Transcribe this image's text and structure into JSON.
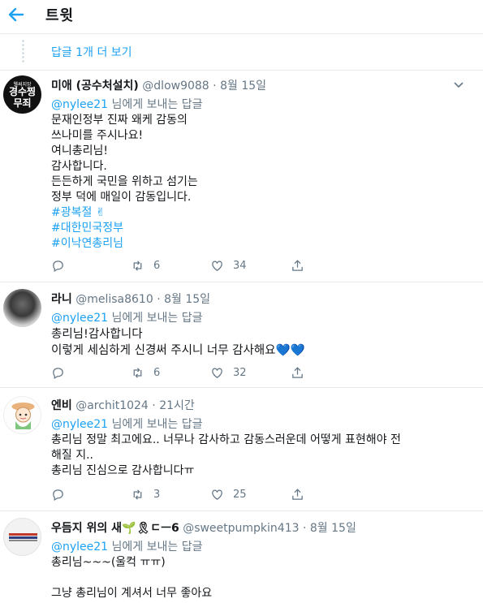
{
  "header": {
    "title": "트윗"
  },
  "more_replies": {
    "label": "답글 1개 더 보기"
  },
  "tweets": [
    {
      "name": "미애 (공수처설치)",
      "handle": "@dlow9088",
      "sep": "·",
      "time": "8월 15일",
      "avatar_text": [
        "경수찡",
        "무죄"
      ],
      "avatar_small": "웰써지망",
      "reply_to": "@nylee21",
      "reply_suffix": " 님에게 보내는 답글",
      "lines": [
        "문재인정부  진짜 왜케 감동의",
        "쓰나미를 주시나요!",
        "여니총리님!",
        "감사합니다.",
        "든든하게 국민을 위하고 섬기는",
        "정부 덕에 매일이 감동입니다."
      ],
      "tags": [
        "#광복절 ✌",
        "#대한민국정부",
        "#이낙연총리님"
      ],
      "retweets": "6",
      "likes": "34"
    },
    {
      "name": "라니",
      "handle": "@melisa8610",
      "sep": "·",
      "time": "8월 15일",
      "reply_to": "@nylee21",
      "reply_suffix": " 님에게 보내는 답글",
      "lines": [
        "총리님!감사합니다",
        "이렇게 세심하게 신경써 주시니 너무 감사해요💙💙"
      ],
      "tags": [],
      "retweets": "6",
      "likes": "32"
    },
    {
      "name": "엔비",
      "handle": "@archit1024",
      "sep": "·",
      "time": "21시간",
      "reply_to": "@nylee21",
      "reply_suffix": " 님에게 보내는 답글",
      "lines": [
        "총리님 정말 최고에요.. 너무나 감사하고 감동스러운데 어떻게 표현해야 전",
        "해질 지..",
        "총리님 진심으로 감사합니다ㅠ"
      ],
      "tags": [],
      "retweets": "3",
      "likes": "25"
    },
    {
      "name": "우듬지 위의 새🌱🎗ㄷㅡ6",
      "handle": "@sweetpumpkin413",
      "sep": "·",
      "time": "8월 15일",
      "reply_to": "@nylee21",
      "reply_suffix": " 님에게 보내는 답글",
      "lines": [
        "총리님~~~(울컥 ㅠㅠ)",
        "",
        "그냥 총리님이 계셔서 너무 좋아요"
      ],
      "tags": [],
      "retweets": "",
      "likes": ""
    }
  ],
  "colors": {
    "accent": "#1da1f2",
    "muted": "#657786",
    "text": "#14171a",
    "border": "#e6ecf0"
  },
  "icons": {
    "back": "arrow-left-icon",
    "chevron": "chevron-down-icon",
    "reply": "reply-icon",
    "retweet": "retweet-icon",
    "like": "heart-icon",
    "share": "share-icon"
  }
}
